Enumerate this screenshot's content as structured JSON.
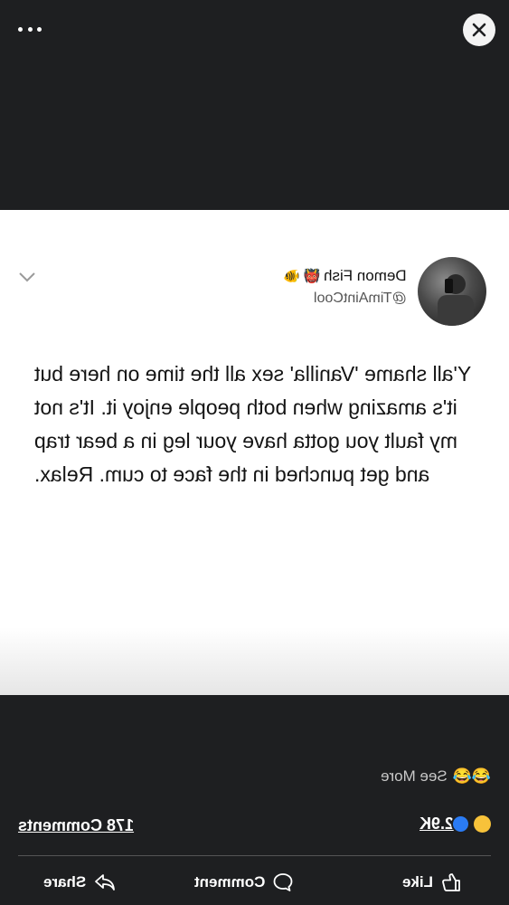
{
  "viewer": {
    "more_label": "More options",
    "close_label": "Close"
  },
  "tweet": {
    "name": "Demon Fish",
    "emoji_1": "👹",
    "emoji_2": "🐠",
    "handle": "@TimAintCool",
    "text": "Y'all shame 'Vanilla' sex all the time on here but it's amazing when both people enjoy it. It's not my fault you gotta have your leg in a bear trap and get punched in the face to cum. Relax."
  },
  "post": {
    "see_more_emoji": "😂😂",
    "see_more": "See More",
    "reaction_count": "2.9K",
    "comments": "178 Comments",
    "like": "Like",
    "comment": "Comment",
    "share": "Share"
  },
  "colors": {
    "background": "#1e1f21",
    "card": "#ffffff",
    "like_blue": "#2a7bf4",
    "laugh_yellow": "#f7c23a"
  }
}
